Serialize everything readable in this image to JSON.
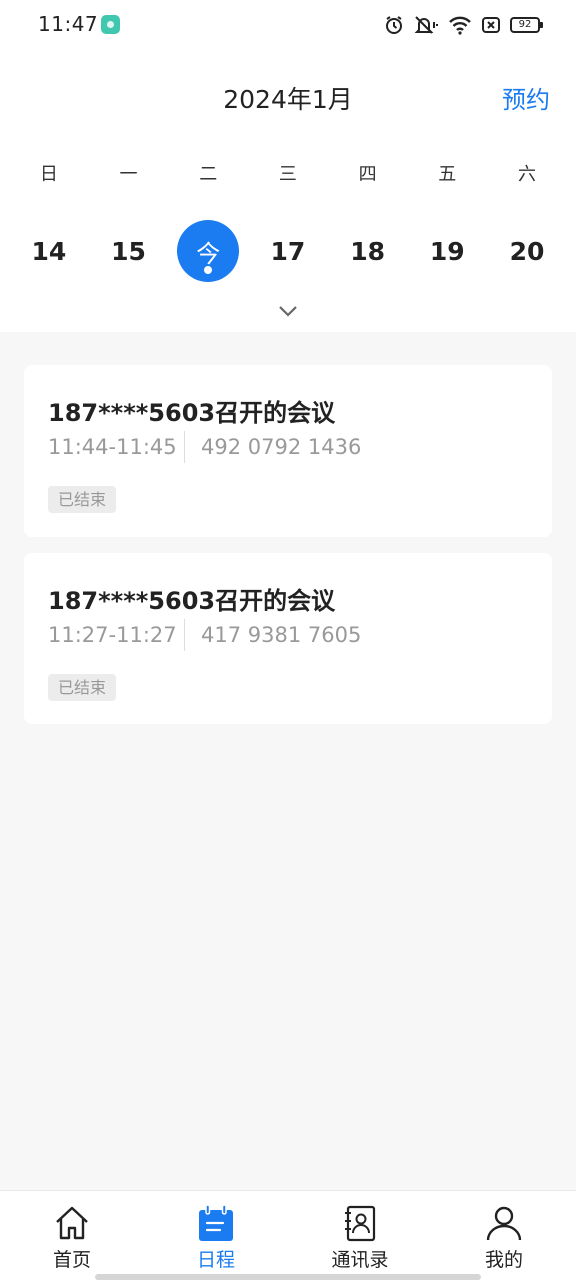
{
  "status_bar": {
    "time": "11:47",
    "battery": "92",
    "icons": [
      "alarm-icon",
      "mute-icon",
      "wifi-icon",
      "sim-off-icon",
      "battery-icon"
    ]
  },
  "header": {
    "month_title": "2024年1月",
    "reserve_label": "预约"
  },
  "calendar": {
    "weekdays": [
      "日",
      "一",
      "二",
      "三",
      "四",
      "五",
      "六"
    ],
    "dates": [
      "14",
      "15",
      "今",
      "17",
      "18",
      "19",
      "20"
    ],
    "today_index": 2
  },
  "meetings": [
    {
      "title": "187****5603召开的会议",
      "time": "11:44-11:45",
      "meeting_id": "492 0792 1436",
      "status": "已结束"
    },
    {
      "title": "187****5603召开的会议",
      "time": "11:27-11:27",
      "meeting_id": "417 9381 7605",
      "status": "已结束"
    }
  ],
  "bottom_nav": {
    "items": [
      {
        "label": "首页",
        "icon": "home-icon"
      },
      {
        "label": "日程",
        "icon": "calendar-icon"
      },
      {
        "label": "通讯录",
        "icon": "contacts-icon"
      },
      {
        "label": "我的",
        "icon": "profile-icon"
      }
    ],
    "active_index": 1
  },
  "colors": {
    "accent": "#1a7cf0",
    "background": "#f7f7f7",
    "card": "#ffffff",
    "muted_text": "#999999"
  }
}
